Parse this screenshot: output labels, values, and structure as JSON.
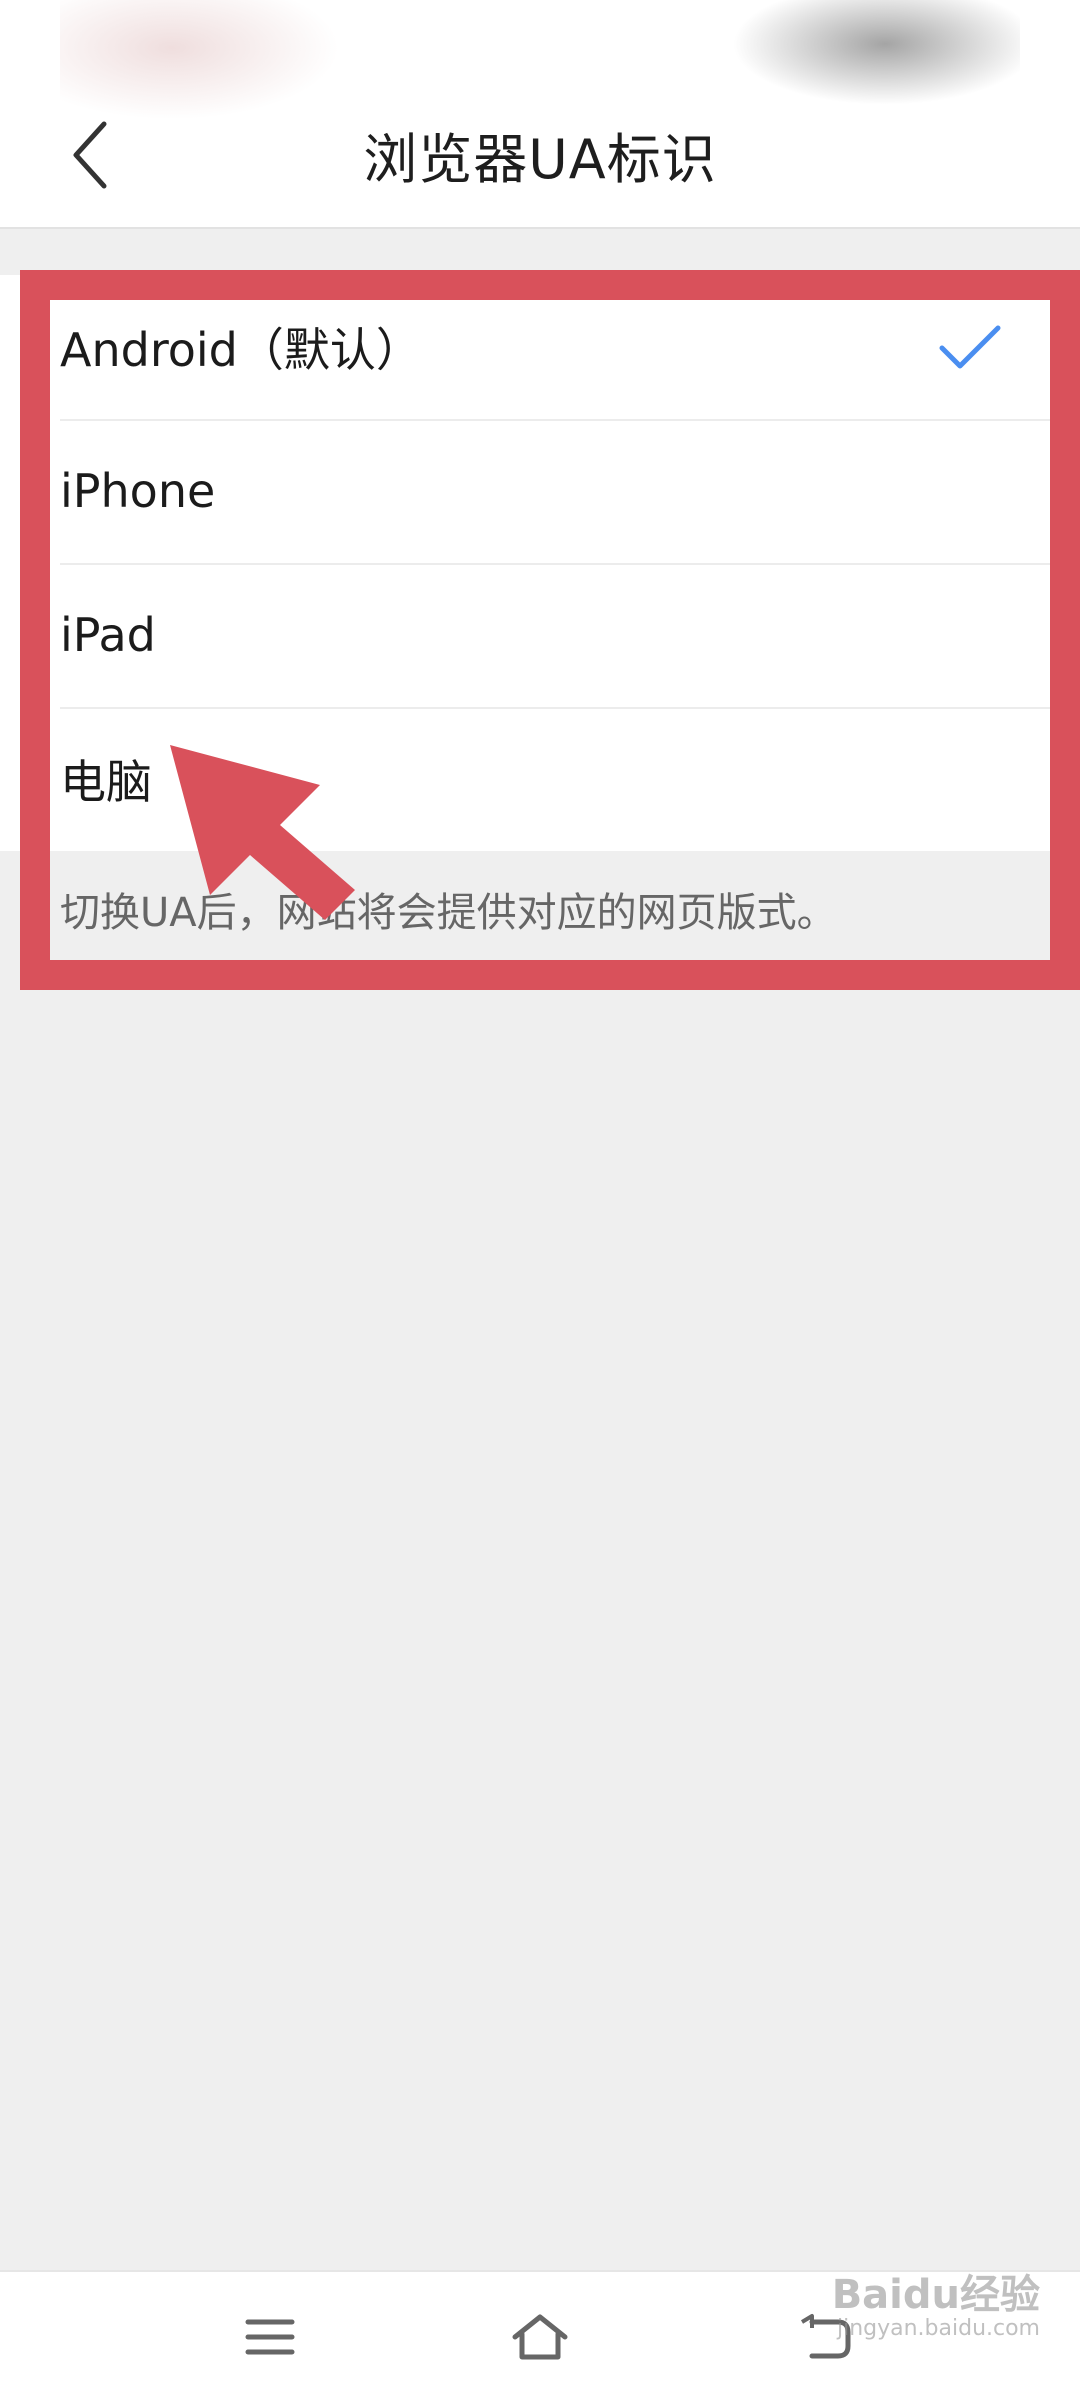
{
  "header": {
    "title": "浏览器UA标识",
    "back_icon": "chevron-left-icon"
  },
  "ua_options": [
    {
      "label": "Android（默认）",
      "selected": true
    },
    {
      "label": "iPhone",
      "selected": false
    },
    {
      "label": "iPad",
      "selected": false
    },
    {
      "label": "电脑",
      "selected": false
    }
  ],
  "hint": "切换UA后，网站将会提供对应的网页版式。",
  "colors": {
    "check": "#4a8ef0",
    "annotation": "#d9515b",
    "background": "#efefef"
  },
  "bottom_nav": [
    {
      "icon": "menu-icon"
    },
    {
      "icon": "home-icon"
    },
    {
      "icon": "back-icon"
    }
  ],
  "watermark": {
    "main": "Baidu经验",
    "sub": "jingyan.baidu.com"
  }
}
